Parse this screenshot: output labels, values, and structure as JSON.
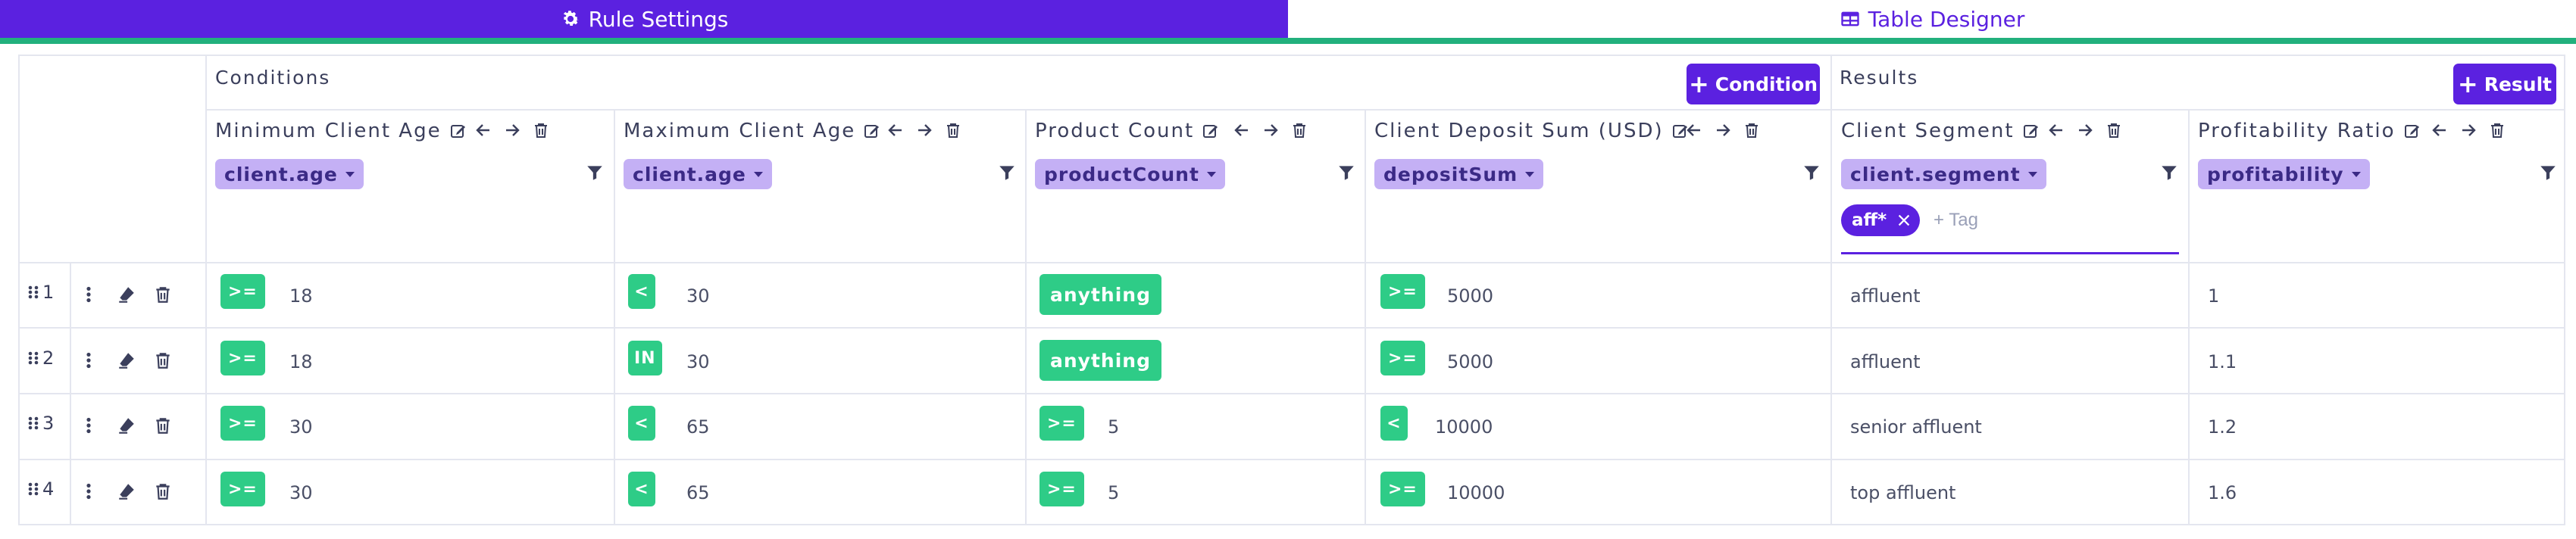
{
  "tabs": [
    {
      "label": "Rule Settings",
      "icon": "gear-icon",
      "active": true
    },
    {
      "label": "Table Designer",
      "icon": "table-icon",
      "active": false
    }
  ],
  "conditions": {
    "title": "Conditions",
    "add_label": "Condition",
    "columns": [
      {
        "label": "Minimum Client Age",
        "field": "client.age"
      },
      {
        "label": "Maximum Client Age",
        "field": "client.age"
      },
      {
        "label": "Product Count",
        "field": "productCount"
      },
      {
        "label": "Client Deposit Sum (USD)",
        "field": "depositSum"
      }
    ]
  },
  "results": {
    "title": "Results",
    "add_label": "Result",
    "columns": [
      {
        "label": "Client Segment",
        "field": "client.segment"
      },
      {
        "label": "Profitability Ratio",
        "field": "profitability"
      }
    ]
  },
  "segment_filter": {
    "tag": "aff*",
    "placeholder": "+ Tag"
  },
  "rows": [
    {
      "num": "1",
      "c": [
        {
          "op": ">=",
          "val": "18"
        },
        {
          "op": "<",
          "val": "30"
        },
        {
          "op": "anything",
          "val": ""
        },
        {
          "op": ">=",
          "val": "5000"
        }
      ],
      "r": [
        "affluent",
        "1"
      ]
    },
    {
      "num": "2",
      "c": [
        {
          "op": ">=",
          "val": "18"
        },
        {
          "op": "IN",
          "val": "30"
        },
        {
          "op": "anything",
          "val": ""
        },
        {
          "op": ">=",
          "val": "5000"
        }
      ],
      "r": [
        "affluent",
        "1.1"
      ]
    },
    {
      "num": "3",
      "c": [
        {
          "op": ">=",
          "val": "30"
        },
        {
          "op": "<",
          "val": "65"
        },
        {
          "op": ">=",
          "val": "5"
        },
        {
          "op": "<",
          "val": "10000"
        }
      ],
      "r": [
        "senior affluent",
        "1.2"
      ]
    },
    {
      "num": "4",
      "c": [
        {
          "op": ">=",
          "val": "30"
        },
        {
          "op": "<",
          "val": "65"
        },
        {
          "op": ">=",
          "val": "5"
        },
        {
          "op": ">=",
          "val": "10000"
        }
      ],
      "r": [
        "top affluent",
        "1.6"
      ]
    }
  ],
  "colors": {
    "accent": "#5b21e0",
    "operator": "#2ecc87",
    "chip": "#c4b0f5",
    "tab_underline": "#22b07d"
  }
}
